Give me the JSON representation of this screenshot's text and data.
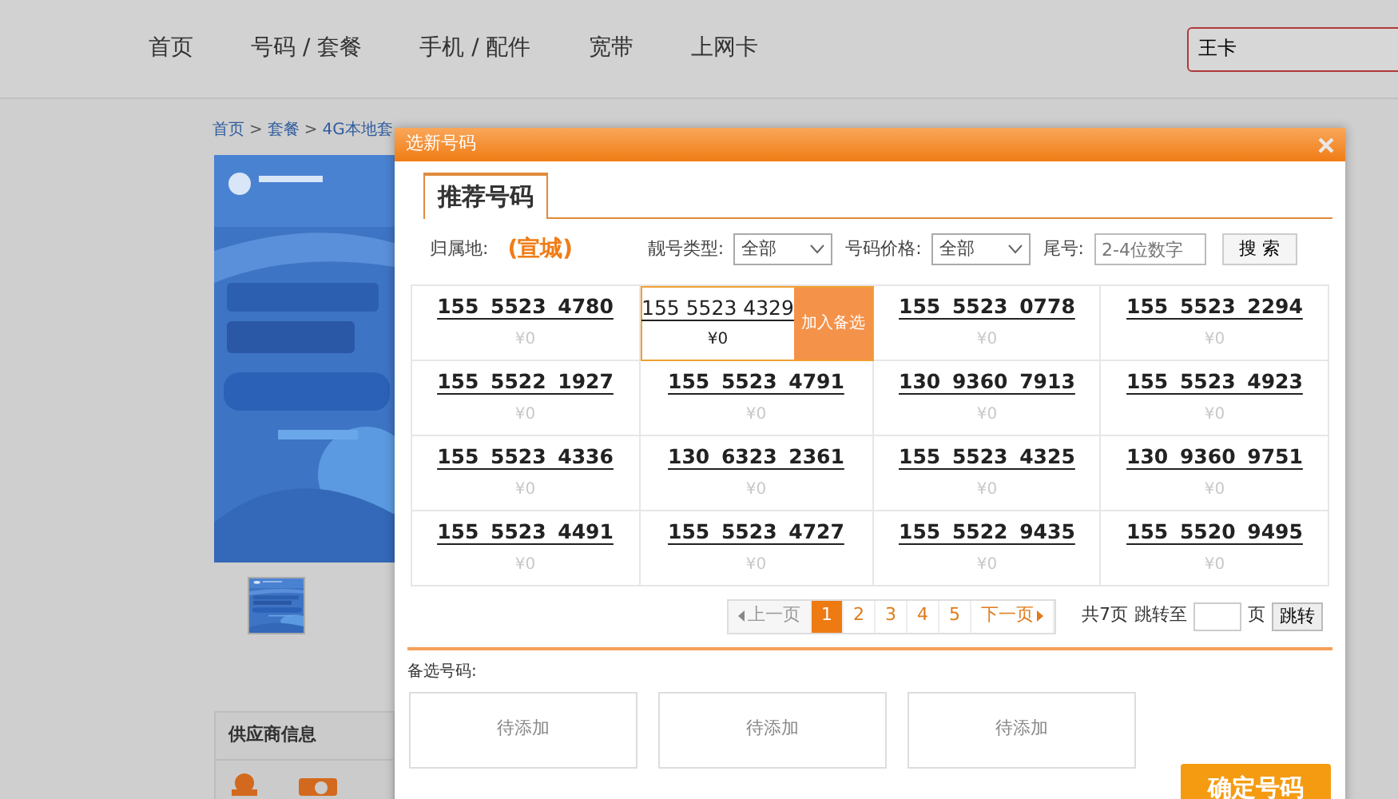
{
  "header": {
    "nav": [
      {
        "label": "首页"
      },
      {
        "label": "号码 / 套餐"
      },
      {
        "label": "手机 / 配件"
      },
      {
        "label": "宽带"
      },
      {
        "label": "上网卡"
      }
    ],
    "search": {
      "value": "王卡"
    }
  },
  "breadcrumb": [
    {
      "label": "首页",
      "separator": ">"
    },
    {
      "label": "套餐",
      "separator": ">"
    },
    {
      "label": "4G本地套"
    }
  ],
  "sidebar": {
    "supplier_title": "供应商信息"
  },
  "dialog": {
    "title": "选新号码",
    "tabs": [
      {
        "label": "推荐号码",
        "selected": true
      }
    ],
    "filters": {
      "region_label": "归属地:",
      "region": "(宣城)",
      "type_label": "靓号类型:",
      "type": "全部",
      "price_label": "号码价格:",
      "price": "全部",
      "tail_label": "尾号:",
      "tail_placeholder": "2-4位数字",
      "search_button": "搜 索"
    },
    "numbers": [
      {
        "number": "155 5523 4780",
        "price": "¥0",
        "hovered": false
      },
      {
        "number": "155 5523 4329",
        "price": "¥0",
        "hovered": true,
        "add_button": "加入备选"
      },
      {
        "number": "155 5523 0778",
        "price": "¥0",
        "hovered": false
      },
      {
        "number": "155 5523 2294",
        "price": "¥0",
        "hovered": false
      },
      {
        "number": "155 5522 1927",
        "price": "¥0",
        "hovered": false
      },
      {
        "number": "155 5523 4791",
        "price": "¥0",
        "hovered": false
      },
      {
        "number": "130 9360 7913",
        "price": "¥0",
        "hovered": false
      },
      {
        "number": "155 5523 4923",
        "price": "¥0",
        "hovered": false
      },
      {
        "number": "155 5523 4336",
        "price": "¥0",
        "hovered": false
      },
      {
        "number": "130 6323 2361",
        "price": "¥0",
        "hovered": false
      },
      {
        "number": "155 5523 4325",
        "price": "¥0",
        "hovered": false
      },
      {
        "number": "130 9360 9751",
        "price": "¥0",
        "hovered": false
      },
      {
        "number": "155 5523 4491",
        "price": "¥0",
        "hovered": false
      },
      {
        "number": "155 5523 4727",
        "price": "¥0",
        "hovered": false
      },
      {
        "number": "155 5522 9435",
        "price": "¥0",
        "hovered": false
      },
      {
        "number": "155 5520 9495",
        "price": "¥0",
        "hovered": false
      }
    ],
    "pagination": {
      "prev": "上一页",
      "pages": [
        {
          "label": "1",
          "selected": true
        },
        {
          "label": "2",
          "selected": false
        },
        {
          "label": "3",
          "selected": false
        },
        {
          "label": "4",
          "selected": false
        },
        {
          "label": "5",
          "selected": false
        }
      ],
      "next": "下一页",
      "total": "共7页",
      "jump_label": "跳转至",
      "page_unit": "页",
      "jump_button": "跳转"
    },
    "backup_label": "备选号码:",
    "slots": [
      {
        "label": "待添加"
      },
      {
        "label": "待添加"
      },
      {
        "label": "待添加"
      }
    ],
    "confirm_button": "确定号码"
  }
}
